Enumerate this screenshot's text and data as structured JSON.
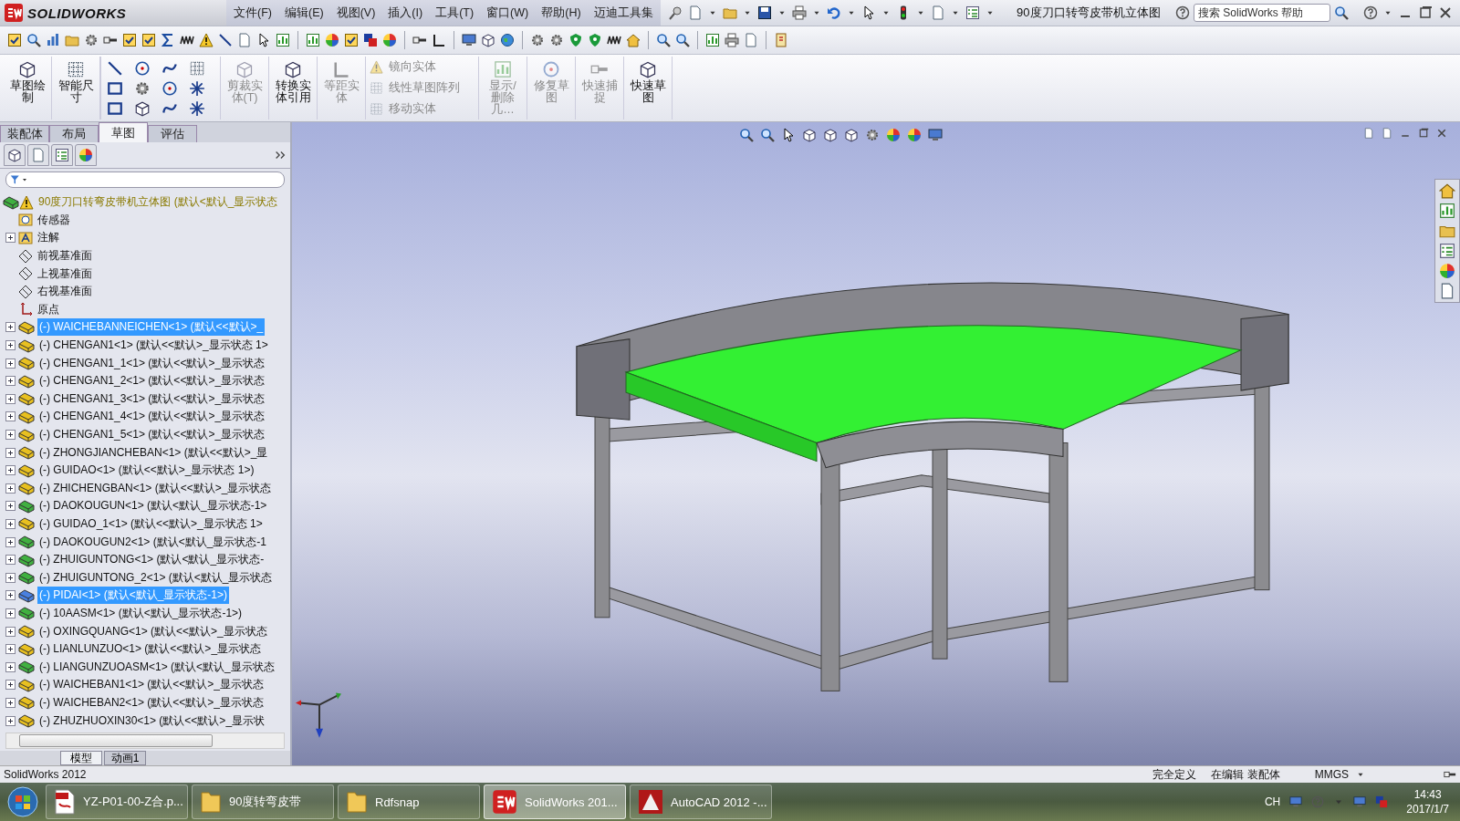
{
  "app": {
    "name": "SOLIDWORKS",
    "document_title": "90度刀口转弯皮带机立体图"
  },
  "menu": [
    "文件(F)",
    "编辑(E)",
    "视图(V)",
    "插入(I)",
    "工具(T)",
    "窗口(W)",
    "帮助(H)",
    "迈迪工具集"
  ],
  "search": {
    "placeholder": "搜索 SolidWorks 帮助"
  },
  "ribbon": [
    {
      "kind": "large",
      "label": "草图绘制",
      "disabled": false
    },
    {
      "kind": "large",
      "label": "智能尺寸",
      "disabled": false
    },
    {
      "kind": "tools"
    },
    {
      "kind": "large",
      "label": "剪裁实体(T)",
      "disabled": true
    },
    {
      "kind": "large",
      "label": "转换实体引用",
      "disabled": false
    },
    {
      "kind": "large",
      "label": "等距实体",
      "disabled": true
    },
    {
      "kind": "list",
      "items": [
        {
          "label": "镜向实体",
          "disabled": true
        },
        {
          "label": "线性草图阵列",
          "disabled": true
        },
        {
          "label": "移动实体",
          "disabled": true
        }
      ]
    },
    {
      "kind": "large",
      "label": "显示/删除几…",
      "disabled": true
    },
    {
      "kind": "large",
      "label": "修复草图",
      "disabled": true
    },
    {
      "kind": "large",
      "label": "快速捕捉",
      "disabled": true
    },
    {
      "kind": "large",
      "label": "快速草图",
      "disabled": false
    }
  ],
  "command_tabs": [
    {
      "label": "装配体",
      "selected": false
    },
    {
      "label": "布局",
      "selected": false
    },
    {
      "label": "草图",
      "selected": true
    },
    {
      "label": "评估",
      "selected": false
    }
  ],
  "tree": {
    "label": "90度刀口转弯皮带机立体图 (默认<默认_显示状态",
    "selected": false,
    "children": [
      {
        "kind": "sensors",
        "label": "传感器",
        "selected": false
      },
      {
        "kind": "annotations",
        "label": "注解",
        "selected": false,
        "expanded": false
      },
      {
        "kind": "plane",
        "label": "前视基准面",
        "selected": false
      },
      {
        "kind": "plane",
        "label": "上视基准面",
        "selected": false
      },
      {
        "kind": "plane",
        "label": "右视基准面",
        "selected": false
      },
      {
        "kind": "origin",
        "label": "原点",
        "selected": false
      },
      {
        "kind": "component",
        "label": "(-) WAICHEBANNEICHEN<1> (默认<<默认>_",
        "selected": true,
        "expanded": false,
        "color": "#e8c020"
      },
      {
        "kind": "component",
        "label": "(-) CHENGAN1<1> (默认<<默认>_显示状态 1>",
        "selected": false,
        "expanded": false,
        "color": "#e8c020"
      },
      {
        "kind": "component",
        "label": "(-) CHENGAN1_1<1> (默认<<默认>_显示状态",
        "selected": false,
        "expanded": false,
        "color": "#e8c020"
      },
      {
        "kind": "component",
        "label": "(-) CHENGAN1_2<1> (默认<<默认>_显示状态",
        "selected": false,
        "expanded": false,
        "color": "#e8c020"
      },
      {
        "kind": "component",
        "label": "(-) CHENGAN1_3<1> (默认<<默认>_显示状态",
        "selected": false,
        "expanded": false,
        "color": "#e8c020"
      },
      {
        "kind": "component",
        "label": "(-) CHENGAN1_4<1> (默认<<默认>_显示状态",
        "selected": false,
        "expanded": false,
        "color": "#e8c020"
      },
      {
        "kind": "component",
        "label": "(-) CHENGAN1_5<1> (默认<<默认>_显示状态",
        "selected": false,
        "expanded": false,
        "color": "#e8c020"
      },
      {
        "kind": "component",
        "label": "(-) ZHONGJIANCHEBAN<1> (默认<<默认>_显",
        "selected": false,
        "expanded": false,
        "color": "#e8c020"
      },
      {
        "kind": "component",
        "label": "(-) GUIDAO<1> (默认<<默认>_显示状态 1>)",
        "selected": false,
        "expanded": false,
        "color": "#e8c020"
      },
      {
        "kind": "component",
        "label": "(-) ZHICHENGBAN<1> (默认<<默认>_显示状态",
        "selected": false,
        "expanded": false,
        "color": "#e8c020"
      },
      {
        "kind": "component",
        "label": "(-) DAOKOUGUN<1> (默认<默认_显示状态-1>",
        "selected": false,
        "expanded": false,
        "color": "#40b040"
      },
      {
        "kind": "component",
        "label": "(-) GUIDAO_1<1> (默认<<默认>_显示状态 1>",
        "selected": false,
        "expanded": false,
        "color": "#e8c020"
      },
      {
        "kind": "component",
        "label": "(-) DAOKOUGUN2<1> (默认<默认_显示状态-1",
        "selected": false,
        "expanded": false,
        "color": "#40b040"
      },
      {
        "kind": "component",
        "label": "(-) ZHUIGUNTONG<1> (默认<默认_显示状态-",
        "selected": false,
        "expanded": false,
        "color": "#40b040"
      },
      {
        "kind": "component",
        "label": "(-) ZHUIGUNTONG_2<1> (默认<默认_显示状态",
        "selected": false,
        "expanded": false,
        "color": "#40b040"
      },
      {
        "kind": "component",
        "label": "(-) PIDAI<1> (默认<默认_显示状态-1>)",
        "selected": true,
        "expanded": false,
        "color": "#4a80e0"
      },
      {
        "kind": "component",
        "label": "(-) 10AASM<1> (默认<默认_显示状态-1>)",
        "selected": false,
        "expanded": false,
        "color": "#40b040"
      },
      {
        "kind": "component",
        "label": "(-) OXINGQUANG<1> (默认<<默认>_显示状态",
        "selected": false,
        "expanded": false,
        "color": "#e8c020"
      },
      {
        "kind": "component",
        "label": "(-) LIANLUNZUO<1> (默认<<默认>_显示状态",
        "selected": false,
        "expanded": false,
        "color": "#e8c020"
      },
      {
        "kind": "component",
        "label": "(-) LIANGUNZUOASM<1> (默认<默认_显示状态",
        "selected": false,
        "expanded": false,
        "color": "#40b040"
      },
      {
        "kind": "component",
        "label": "(-) WAICHEBAN1<1> (默认<<默认>_显示状态",
        "selected": false,
        "expanded": false,
        "color": "#e8c020"
      },
      {
        "kind": "component",
        "label": "(-) WAICHEBAN2<1> (默认<<默认>_显示状态",
        "selected": false,
        "expanded": false,
        "color": "#e8c020"
      },
      {
        "kind": "component",
        "label": "(-) ZHUZHUOXIN30<1> (默认<<默认>_显示状",
        "selected": false,
        "expanded": false,
        "color": "#e8c020"
      }
    ]
  },
  "bottom_tabs": [
    {
      "label": "模型",
      "selected": true
    },
    {
      "label": "动画1",
      "selected": false
    }
  ],
  "status_bar": {
    "app": "SolidWorks 2012",
    "state": "完全定义",
    "mode": "在编辑 装配体",
    "units": "MMGS"
  },
  "taskbar": {
    "items": [
      {
        "kind": "pdf",
        "label": "YZ-P01-00-Z合.p...",
        "selected": false
      },
      {
        "kind": "folder",
        "label": "90度转弯皮带",
        "selected": false
      },
      {
        "kind": "folder",
        "label": "Rdfsnap",
        "selected": false
      },
      {
        "kind": "solidworks",
        "label": "SolidWorks 201...",
        "selected": true
      },
      {
        "kind": "autocad",
        "label": "AutoCAD 2012 -...",
        "selected": false
      }
    ],
    "tray": {
      "language": "CH",
      "time": "14:43",
      "date": "2017/1/7"
    }
  }
}
